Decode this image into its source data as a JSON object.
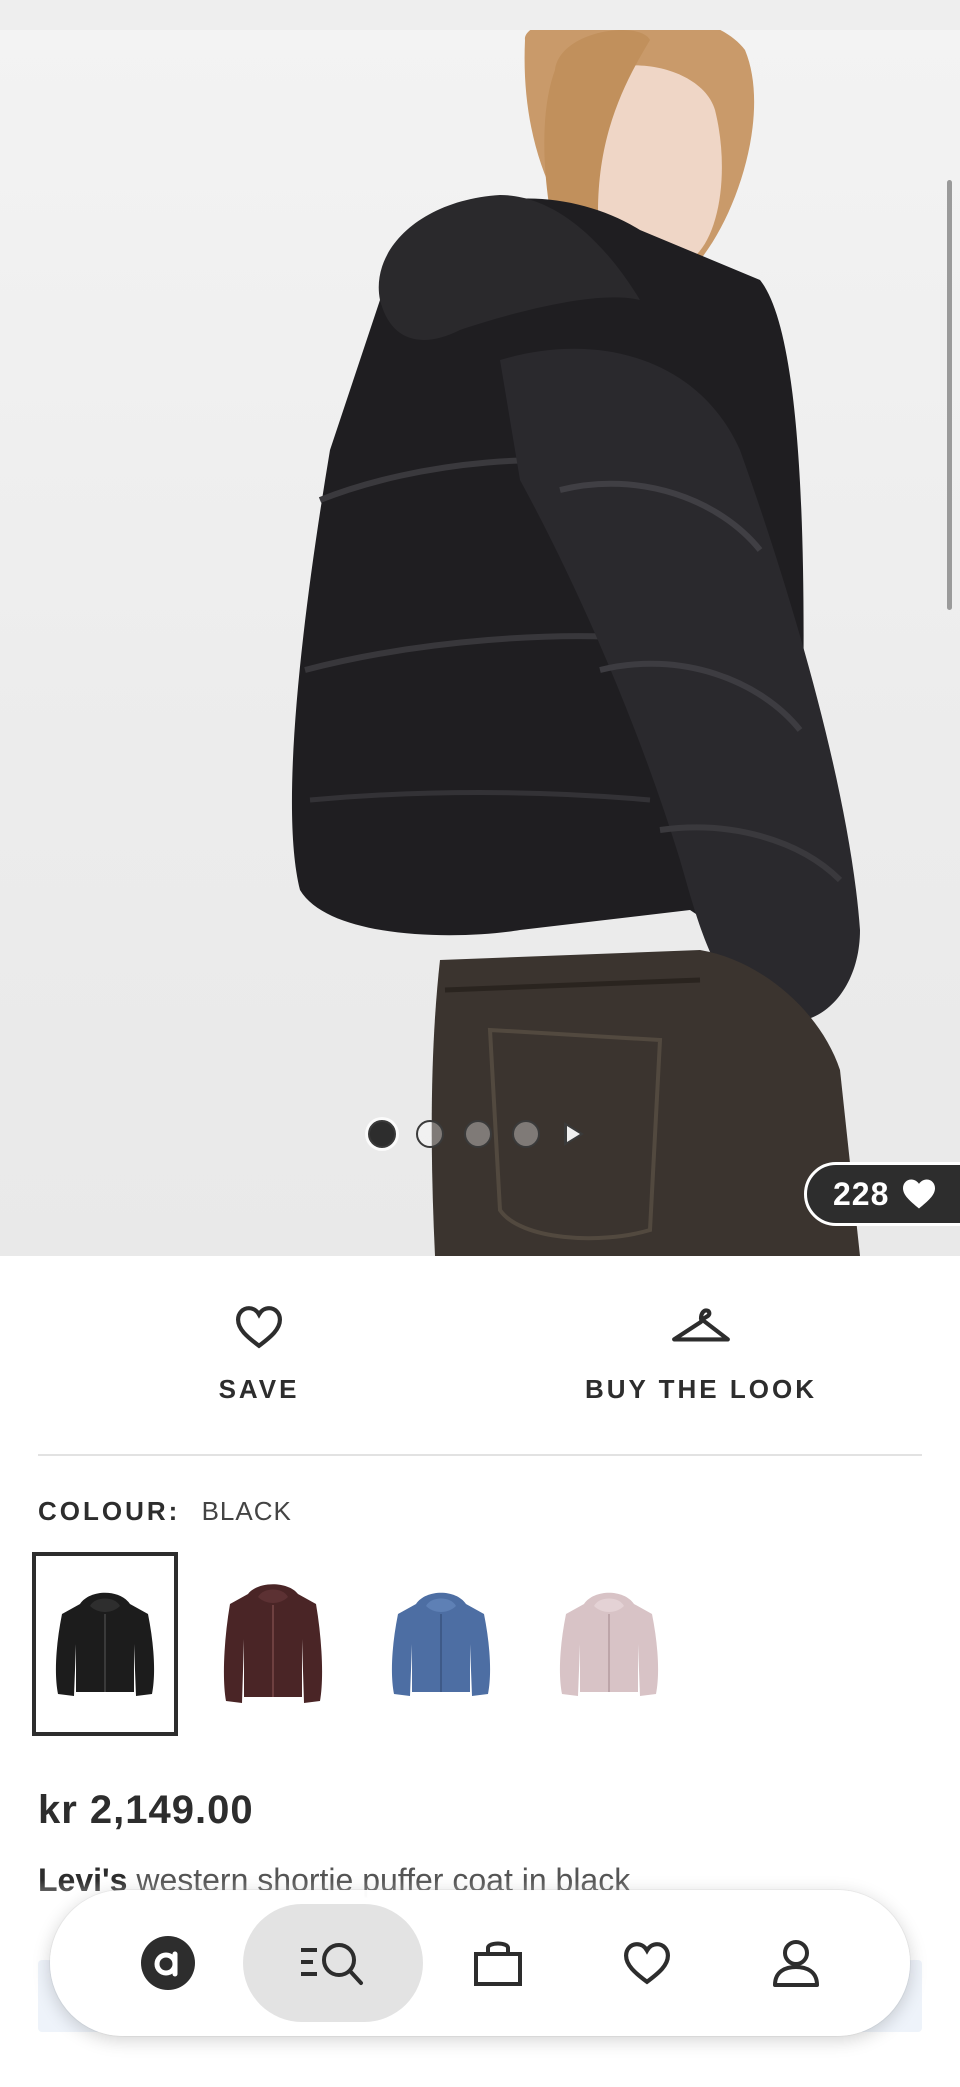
{
  "product": {
    "save_count": "228",
    "save_label": "SAVE",
    "buy_the_look_label": "BUY THE LOOK",
    "colour_key": "COLOUR:",
    "colour_value": "BLACK",
    "price": "kr 2,149.00",
    "brand": "Levi's",
    "name": "western shortie puffer coat in black"
  },
  "gallery": {
    "image_count": 4,
    "current_index": 0
  },
  "swatches": [
    {
      "name": "black",
      "color": "#1c1c1c",
      "selected": true
    },
    {
      "name": "burgundy",
      "color": "#4a2526",
      "selected": false
    },
    {
      "name": "blue",
      "color": "#4d6ea3",
      "selected": false
    },
    {
      "name": "pink",
      "color": "#d8c3c6",
      "selected": false
    }
  ],
  "bottom_nav": {
    "items": [
      "home-icon",
      "search-icon",
      "bag-icon",
      "saved-icon",
      "account-icon"
    ],
    "active": "search-icon"
  },
  "colors": {
    "text": "#2d2d2d",
    "nav_active": "#e3e3e3",
    "badge_bg": "#2d2d2d"
  }
}
